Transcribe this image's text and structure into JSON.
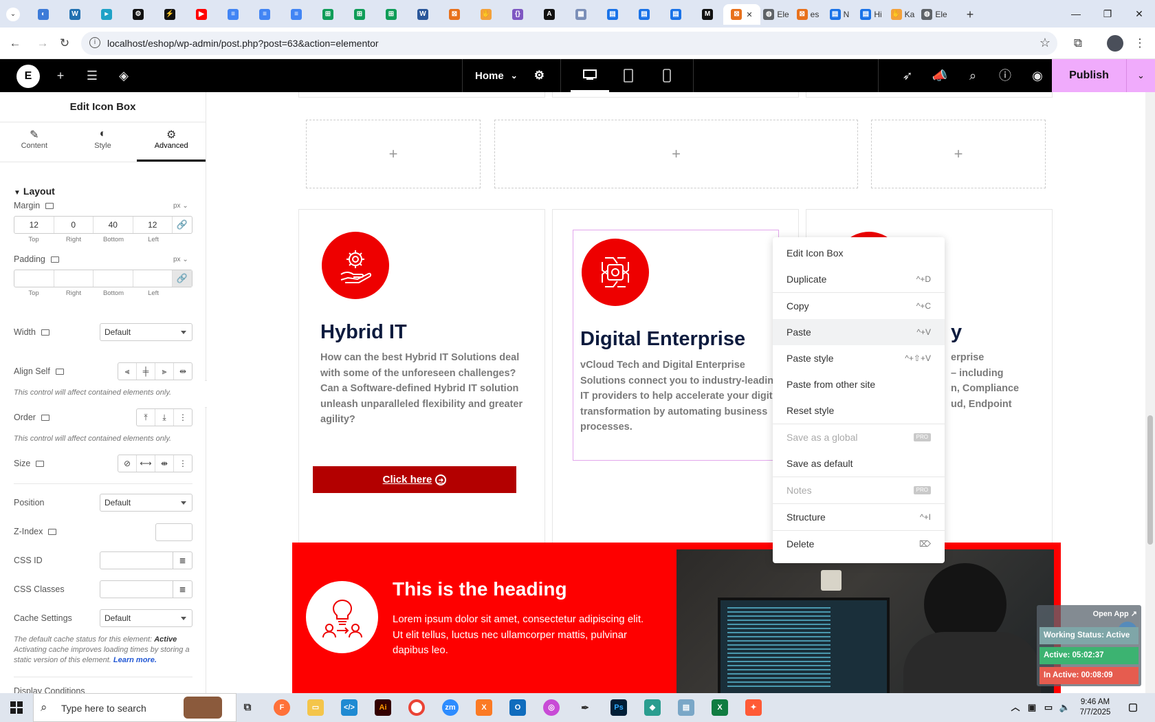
{
  "browser": {
    "tabs": [
      {
        "icon": "firefox-icon",
        "color": "#3d7bd8",
        "label": ""
      },
      {
        "icon": "wordpress-icon",
        "color": "#2271b1",
        "label": ""
      },
      {
        "icon": "tab-icon",
        "color": "#1fa2c7",
        "label": ""
      },
      {
        "icon": "chatgpt-icon",
        "color": "#111111",
        "label": ""
      },
      {
        "icon": "bolt-icon",
        "color": "#111111",
        "label": ""
      },
      {
        "icon": "youtube-icon",
        "color": "#ff0000",
        "label": ""
      },
      {
        "icon": "docs-icon",
        "color": "#4285f4",
        "label": ""
      },
      {
        "icon": "docs-icon",
        "color": "#4285f4",
        "label": ""
      },
      {
        "icon": "docs-icon",
        "color": "#4285f4",
        "label": ""
      },
      {
        "icon": "sheets-icon",
        "color": "#0f9d58",
        "label": ""
      },
      {
        "icon": "sheets-icon",
        "color": "#0f9d58",
        "label": ""
      },
      {
        "icon": "sheets-icon",
        "color": "#0f9d58",
        "label": ""
      },
      {
        "icon": "word-icon",
        "color": "#2b579a",
        "label": ""
      },
      {
        "icon": "xampp-icon",
        "color": "#e8711c",
        "label": ""
      },
      {
        "icon": "hand-icon",
        "color": "#f3a13b",
        "label": ""
      },
      {
        "icon": "code-icon",
        "color": "#7e57c2",
        "label": ""
      },
      {
        "icon": "ai-icon",
        "color": "#111111",
        "label": ""
      },
      {
        "icon": "grid-icon",
        "color": "#7b8fb8",
        "label": ""
      },
      {
        "icon": "forms-icon",
        "color": "#1a73e8",
        "label": ""
      },
      {
        "icon": "forms-icon",
        "color": "#1a73e8",
        "label": ""
      },
      {
        "icon": "forms-icon",
        "color": "#1a73e8",
        "label": ""
      },
      {
        "icon": "medium-icon",
        "color": "#111111",
        "label": ""
      },
      {
        "icon": "xampp-icon",
        "color": "#e8711c",
        "label": "",
        "active": true
      },
      {
        "icon": "globe-icon",
        "color": "#5f6368",
        "label": "Ele"
      },
      {
        "icon": "xampp-icon",
        "color": "#e8711c",
        "label": "es"
      },
      {
        "icon": "forms-icon",
        "color": "#1a73e8",
        "label": "N"
      },
      {
        "icon": "forms-icon",
        "color": "#1a73e8",
        "label": "Hi"
      },
      {
        "icon": "hand-icon",
        "color": "#f3a13b",
        "label": "Ka"
      },
      {
        "icon": "globe-icon",
        "color": "#5f6368",
        "label": "Ele"
      }
    ],
    "new_tab": "+",
    "url": "localhost/eshop/wp-admin/post.php?post=63&action=elementor"
  },
  "topbar": {
    "page": "Home",
    "publish": "Publish"
  },
  "panel": {
    "title": "Edit Icon Box",
    "tabs": [
      {
        "label": "Content",
        "icon": "pencil-icon"
      },
      {
        "label": "Style",
        "icon": "contrast-icon"
      },
      {
        "label": "Advanced",
        "icon": "gear-icon",
        "active": true
      }
    ],
    "section": "Layout",
    "margin": {
      "label": "Margin",
      "unit": "px",
      "top": "12",
      "right": "0",
      "bottom": "40",
      "left": "12"
    },
    "padding": {
      "label": "Padding",
      "unit": "px",
      "top": "",
      "right": "",
      "bottom": "",
      "left": ""
    },
    "side_labels": [
      "Top",
      "Right",
      "Bottom",
      "Left"
    ],
    "width": {
      "label": "Width",
      "value": "Default"
    },
    "align_self": {
      "label": "Align Self",
      "note": "This control will affect contained elements only."
    },
    "order": {
      "label": "Order",
      "note": "This control will affect contained elements only."
    },
    "size": {
      "label": "Size"
    },
    "position": {
      "label": "Position",
      "value": "Default"
    },
    "zindex": {
      "label": "Z-Index"
    },
    "css_id": {
      "label": "CSS ID"
    },
    "css_classes": {
      "label": "CSS Classes"
    },
    "cache": {
      "label": "Cache Settings",
      "value": "Default"
    },
    "cache_note_1": "The default cache status for this element: ",
    "cache_note_active": "Active",
    "cache_note_2": " Activating cache improves loading times by storing a static version of this element. ",
    "learn_more": "Learn more.",
    "display_conditions": "Display Conditions"
  },
  "canvas": {
    "cards": [
      {
        "title": "Hybrid IT",
        "text": "How can the best Hybrid IT Solutions deal with some of the unforeseen challenges? Can a Software-defined Hybrid IT solution unleash unparalleled flexibility and greater agility?",
        "button": "Click here"
      },
      {
        "title": "Digital Enterprise",
        "text": "vCloud Tech and Digital Enterprise Solutions connect you to industry-leading IT providers to help accelerate your digital transformation by automating business processes."
      },
      {
        "title": "y",
        "text_lines": [
          "erprise",
          "– including",
          "n, Compliance",
          "ud, Endpoint"
        ]
      }
    ],
    "band": {
      "heading": "This is the heading",
      "text": "Lorem ipsum dolor sit amet, consectetur adipiscing elit. Ut elit tellus, luctus nec ullamcorper mattis, pulvinar dapibus leo."
    }
  },
  "context_menu": [
    {
      "label": "Edit Icon Box",
      "shortcut": ""
    },
    {
      "label": "Duplicate",
      "shortcut": "^+D",
      "sep_after": true
    },
    {
      "label": "Copy",
      "shortcut": "^+C"
    },
    {
      "label": "Paste",
      "shortcut": "^+V",
      "hover": true
    },
    {
      "label": "Paste style",
      "shortcut": "^+⇧+V"
    },
    {
      "label": "Paste from other site",
      "shortcut": ""
    },
    {
      "label": "Reset style",
      "shortcut": "",
      "sep_after": true
    },
    {
      "label": "Save as a global",
      "shortcut": "PRO",
      "disabled": true
    },
    {
      "label": "Save as default",
      "shortcut": "",
      "sep_after": true
    },
    {
      "label": "Notes",
      "shortcut": "PRO",
      "disabled": true,
      "sep_after": true
    },
    {
      "label": "Structure",
      "shortcut": "^+I",
      "sep_after": true
    },
    {
      "label": "Delete",
      "shortcut": "⌦"
    }
  ],
  "work_status": {
    "open_app": "Open App ↗",
    "status": "Working Status: Active",
    "active": "Active: 05:02:37",
    "inactive": "In Active: 00:08:09",
    "colors": {
      "status": "#7fa6a8",
      "active": "#3cb371",
      "inactive": "#e65c4f"
    }
  },
  "taskbar": {
    "search_placeholder": "Type here to search",
    "time": "9:46 AM",
    "date": "7/7/2025"
  },
  "colors": {
    "accent_red": "#ee0000",
    "button_red": "#b30000",
    "publish_pink": "#f0abfc",
    "title_navy": "#0d1b3e"
  }
}
